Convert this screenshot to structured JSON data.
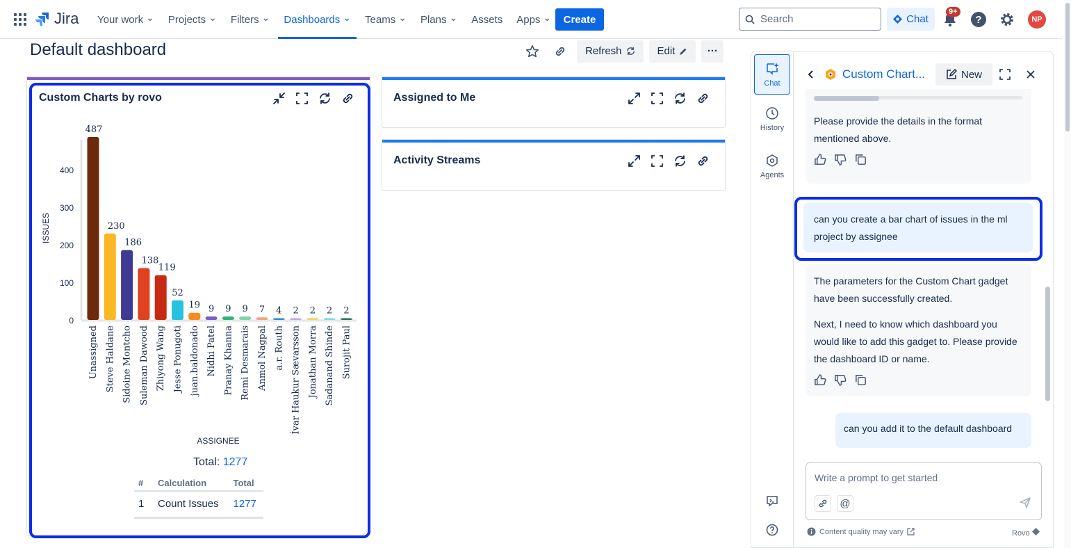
{
  "nav": {
    "logo": "Jira",
    "items": [
      {
        "label": "Your work",
        "active": false
      },
      {
        "label": "Projects",
        "active": false
      },
      {
        "label": "Filters",
        "active": false
      },
      {
        "label": "Dashboards",
        "active": true
      },
      {
        "label": "Teams",
        "active": false
      },
      {
        "label": "Plans",
        "active": false
      },
      {
        "label": "Assets",
        "active": false
      },
      {
        "label": "Apps",
        "active": false
      }
    ],
    "create": "Create",
    "search_placeholder": "Search",
    "chat": "Chat",
    "notif_badge": "9+",
    "avatar": "NP"
  },
  "page": {
    "title": "Default dashboard",
    "refresh": "Refresh",
    "edit": "Edit",
    "more": "···"
  },
  "gadgets": {
    "custom": {
      "title": "Custom Charts by rovo"
    },
    "assigned": {
      "title": "Assigned to Me"
    },
    "activity": {
      "title": "Activity Streams"
    }
  },
  "chart_data": {
    "type": "bar",
    "categories": [
      "Unassigned",
      "Steve Haldane",
      "Sidoine Montcho",
      "Suleman Dawood",
      "Zhiyong Wang",
      "Jesse Ponugoti",
      "juan.baldonado",
      "Nidhi Patel",
      "Pranay Khanna",
      "Remi Desmarais",
      "Anmol Nagpal",
      "a.r. Routh",
      "Ívar Haukur Sævarsson",
      "Jonathan Morra",
      "Sadanand Shinde",
      "Surojit Paul"
    ],
    "values": [
      487,
      230,
      186,
      138,
      119,
      52,
      19,
      9,
      9,
      9,
      7,
      4,
      2,
      2,
      2,
      2
    ],
    "colors": [
      "#6b2a0a",
      "#fbb724",
      "#3f3a93",
      "#e0411f",
      "#c72a12",
      "#27c3de",
      "#f68b1f",
      "#7b5cc8",
      "#2fb37a",
      "#7ed6a8",
      "#f2a37a",
      "#2f8cd8",
      "#c7a6e8",
      "#f8d25a",
      "#7fd8ea",
      "#1e7a52"
    ],
    "xlabel": "ASSIGNEE",
    "ylabel": "ISSUES",
    "yticks": [
      0,
      100,
      200,
      300,
      400
    ],
    "ylim": [
      0,
      500
    ]
  },
  "summary": {
    "total_label": "Total: ",
    "total_value": "1277",
    "headers": [
      "#",
      "Calculation",
      "Total"
    ],
    "row": {
      "index": "1",
      "calc": "Count Issues",
      "total": "1277"
    }
  },
  "rovo": {
    "rail": [
      {
        "label": "Chat",
        "active": true
      },
      {
        "label": "History",
        "active": false
      },
      {
        "label": "Agents",
        "active": false
      }
    ],
    "title": "Custom Chart...",
    "new": "New",
    "messages": {
      "ai1": "Please provide the details in the format mentioned above.",
      "user1": "can you create a bar chart of issues in the ml project by assignee",
      "ai2a": "The parameters for the Custom Chart gadget have been successfully created.",
      "ai2b": "Next, I need to know which dashboard you would like to add this gadget to. Please provide the dashboard ID or name.",
      "user2": "can you add it to the default dashboard"
    },
    "prompt_placeholder": "Write a prompt to get started",
    "footnote": "Content quality may vary",
    "brand": "Rovo"
  }
}
